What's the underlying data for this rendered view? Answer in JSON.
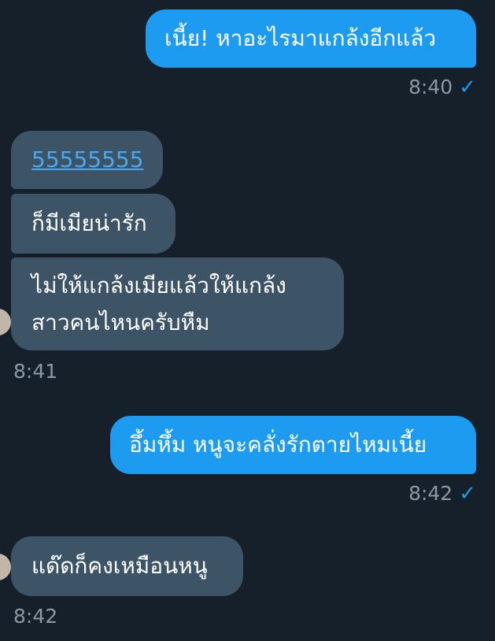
{
  "messages": [
    {
      "text": "เนี้ย! หาอะไรมาแกล้งอีกแล้ว",
      "time": "8:40",
      "check": "✓"
    },
    {
      "link": "55555555"
    },
    {
      "text": "ก็มีเมียน่ารัก"
    },
    {
      "line1": "ไม่ให้แกล้งเมียแล้วให้แกล้ง",
      "line2": "สาวคนไหนครับหืม",
      "time": "8:41"
    },
    {
      "text": "อึ้มหึ้ม หนูจะคลั่งรักตายไหมเนี้ย",
      "time": "8:42",
      "check": "✓"
    },
    {
      "text": "แด๊ดก็คงเหมือนหนู",
      "time": "8:42"
    }
  ]
}
